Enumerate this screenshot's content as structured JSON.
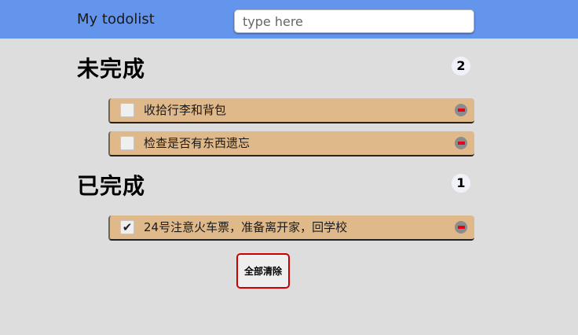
{
  "header": {
    "title": "My todolist",
    "search_placeholder": "type here",
    "background_color": "#6495ed"
  },
  "incomplete": {
    "title": "未完成",
    "count": "2",
    "items": [
      {
        "text": "收拾行李和背包",
        "checked": false
      },
      {
        "text": "检查是否有东西遗忘",
        "checked": false
      }
    ]
  },
  "completed": {
    "title": "已完成",
    "count": "1",
    "items": [
      {
        "text": "24号注意火车票，准备离开家，回学校",
        "checked": true
      }
    ]
  },
  "actions": {
    "clear_all_label": "全部清除",
    "clear_all_border_color": "#cc0000"
  },
  "icons": {
    "remove": "remove-minus-circle-icon",
    "check": "checkmark-icon"
  },
  "colors": {
    "item_background": "#e0b98b",
    "page_background": "#dddddd"
  }
}
